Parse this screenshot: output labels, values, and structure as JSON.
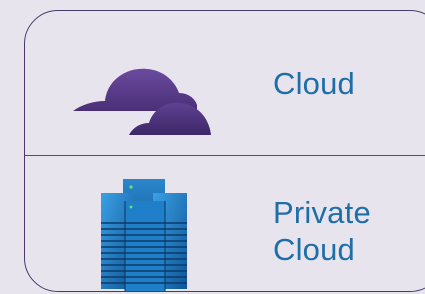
{
  "rows": [
    {
      "label_lines": [
        "Cloud"
      ],
      "icon": "cloud-icon"
    },
    {
      "label_lines": [
        "Private",
        "Cloud"
      ],
      "icon": "server-rack-icon"
    }
  ],
  "colors": {
    "background": "#e8e4ee",
    "border": "#4a3a6a",
    "label_text": "#1e6ea8",
    "cloud_primary": "#5e3f8c",
    "cloud_dark": "#3f2a66",
    "server_blue": "#1a78c2",
    "server_dark": "#0d4a86"
  }
}
